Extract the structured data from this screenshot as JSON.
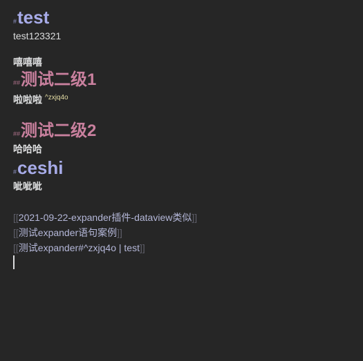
{
  "editor": {
    "h1_marker": "#",
    "h2_marker": "##",
    "heading_test": "test",
    "text_test": "test123321",
    "text_xixi": "嘻嘻嘻",
    "heading_level2_1": "测试二级1",
    "text_lala": "啦啦啦",
    "block_ref": "^zxjq4o",
    "heading_level2_2": "测试二级2",
    "text_haha": "哈哈哈",
    "heading_ceshi": "ceshi",
    "text_zizi": "呲呲呲",
    "link_open": "[[",
    "link_close": "]]",
    "links": [
      "2021-09-22-expander插件-dataview类似",
      "测试expander语句案例",
      "测试expander#^zxjq4o | test"
    ]
  },
  "colors": {
    "background": "#262626",
    "h1": "#a7abe8",
    "h2": "#c9809e",
    "text": "#dcddde",
    "link": "#b4b7d8",
    "bracket": "#5f5f6a",
    "block_ref": "#e7dfa6"
  }
}
